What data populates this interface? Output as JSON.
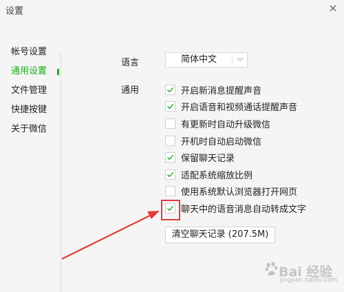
{
  "window": {
    "title": "设置",
    "close_label": "×"
  },
  "sidebar": {
    "items": [
      {
        "label": "帐号设置",
        "active": false
      },
      {
        "label": "通用设置",
        "active": true
      },
      {
        "label": "文件管理",
        "active": false
      },
      {
        "label": "快捷按键",
        "active": false
      },
      {
        "label": "关于微信",
        "active": false
      }
    ]
  },
  "general": {
    "language_label": "语言",
    "language_value": "简体中文",
    "general_label": "通用",
    "options": [
      {
        "label": "开启新消息提醒声音",
        "checked": true
      },
      {
        "label": "开启语音和视频通话提醒声音",
        "checked": true
      },
      {
        "label": "有更新时自动升级微信",
        "checked": false
      },
      {
        "label": "开机时自动启动微信",
        "checked": false
      },
      {
        "label": "保留聊天记录",
        "checked": true
      },
      {
        "label": "适配系统缩放比例",
        "checked": true
      },
      {
        "label": "使用系统默认浏览器打开网页",
        "checked": false
      },
      {
        "label": "聊天中的语音消息自动转成文字",
        "checked": true
      }
    ],
    "clear_button": "清空聊天记录 (207.5M)"
  },
  "watermark": {
    "brand": "Bai 经验",
    "url": "jingyan.baidu.com"
  },
  "colors": {
    "accent": "#1aad19",
    "annotation": "#e43b3b"
  },
  "icons": {
    "checkbox_mark": "check-icon",
    "dropdown": "chevron-down-icon",
    "close": "close-icon"
  }
}
